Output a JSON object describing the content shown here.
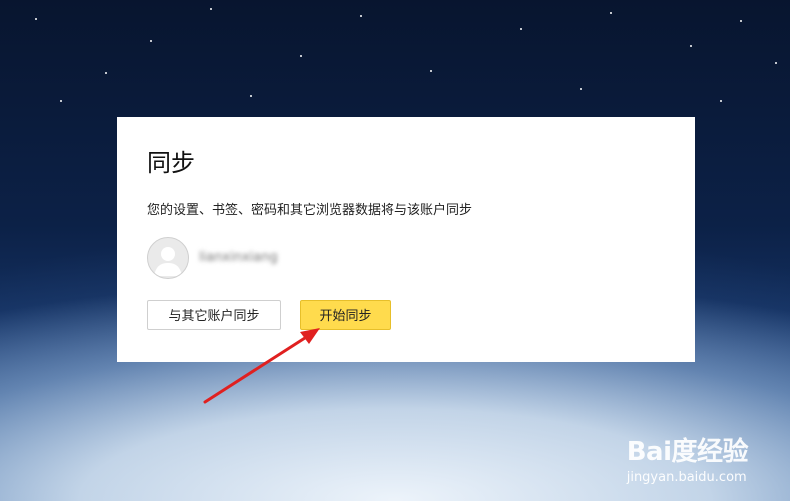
{
  "dialog": {
    "title": "同步",
    "description": "您的设置、书签、密码和其它浏览器数据将与该账户同步",
    "account_name": "lianxinxiang",
    "secondary_button": "与其它账户同步",
    "primary_button": "开始同步"
  },
  "watermark": {
    "logo": "Bai度经验",
    "url": "jingyan.baidu.com"
  },
  "colors": {
    "primary_button": "#ffdb4d",
    "annotation_arrow": "#e02020"
  }
}
